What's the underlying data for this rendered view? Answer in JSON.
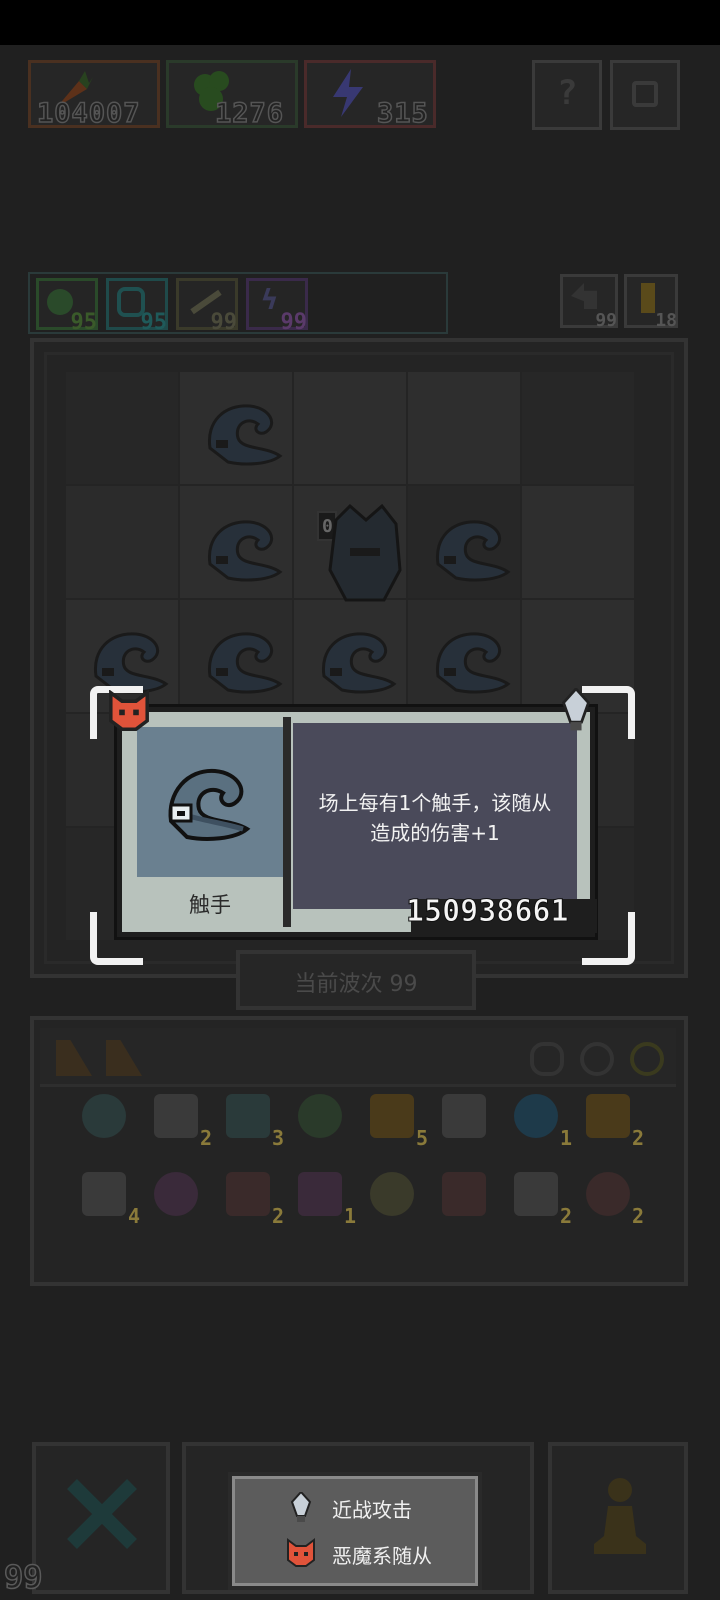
{
  "resources": [
    {
      "name": "carrot",
      "value": "104007",
      "color": "#a04a1a"
    },
    {
      "name": "clover",
      "value": "1276",
      "color": "#3a8a2a"
    },
    {
      "name": "lightning",
      "value": "315",
      "color": "#5a5ad8"
    }
  ],
  "stats": [
    "95",
    "95",
    "99",
    "99"
  ],
  "side_counts": [
    "99",
    "18"
  ],
  "board": {
    "boss_level": "0",
    "wave_label": "当前波次 99"
  },
  "bottom": {
    "count": "99"
  },
  "popup": {
    "unit_name": "触手",
    "description_line1": "场上每有1个触手，该随从",
    "description_line2": "造成的伤害+1",
    "power": "150938661",
    "colors": {
      "demon": "#e0533a",
      "portrait_bg": "#6a8090",
      "desc_bg": "#4a4a5a"
    }
  },
  "inventory_quantities": [
    "2",
    "3",
    "5",
    "1",
    "2",
    "4",
    "2",
    "1",
    "2",
    "2"
  ],
  "legend": {
    "items": [
      {
        "icon": "sword-icon",
        "label": "近战攻击"
      },
      {
        "icon": "demon-icon",
        "label": "恶魔系随从"
      }
    ]
  }
}
